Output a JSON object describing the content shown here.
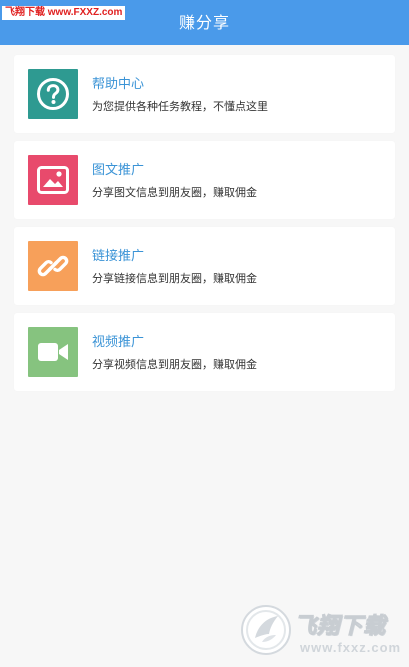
{
  "header": {
    "title": "赚分享"
  },
  "watermark_top": {
    "site_name": "飞翔下载",
    "url": "www.FXXZ.com"
  },
  "cards": [
    {
      "title": "帮助中心",
      "description": "为您提供各种任务教程，不懂点这里",
      "icon": "question-circle-icon",
      "color": "#2e9a91"
    },
    {
      "title": "图文推广",
      "description": "分享图文信息到朋友圈，赚取佣金",
      "icon": "image-icon",
      "color": "#e84a6c"
    },
    {
      "title": "链接推广",
      "description": "分享链接信息到朋友圈，赚取佣金",
      "icon": "link-icon",
      "color": "#f7a05a"
    },
    {
      "title": "视频推广",
      "description": "分享视频信息到朋友圈，赚取佣金",
      "icon": "video-camera-icon",
      "color": "#86c37f"
    }
  ],
  "watermark_bottom": {
    "brand": "飞翔下载",
    "url": "www.fxxz.com"
  },
  "colors": {
    "header_bg": "#4a9aea",
    "page_bg": "#f7f7f7",
    "title_text": "#3a93d6"
  }
}
